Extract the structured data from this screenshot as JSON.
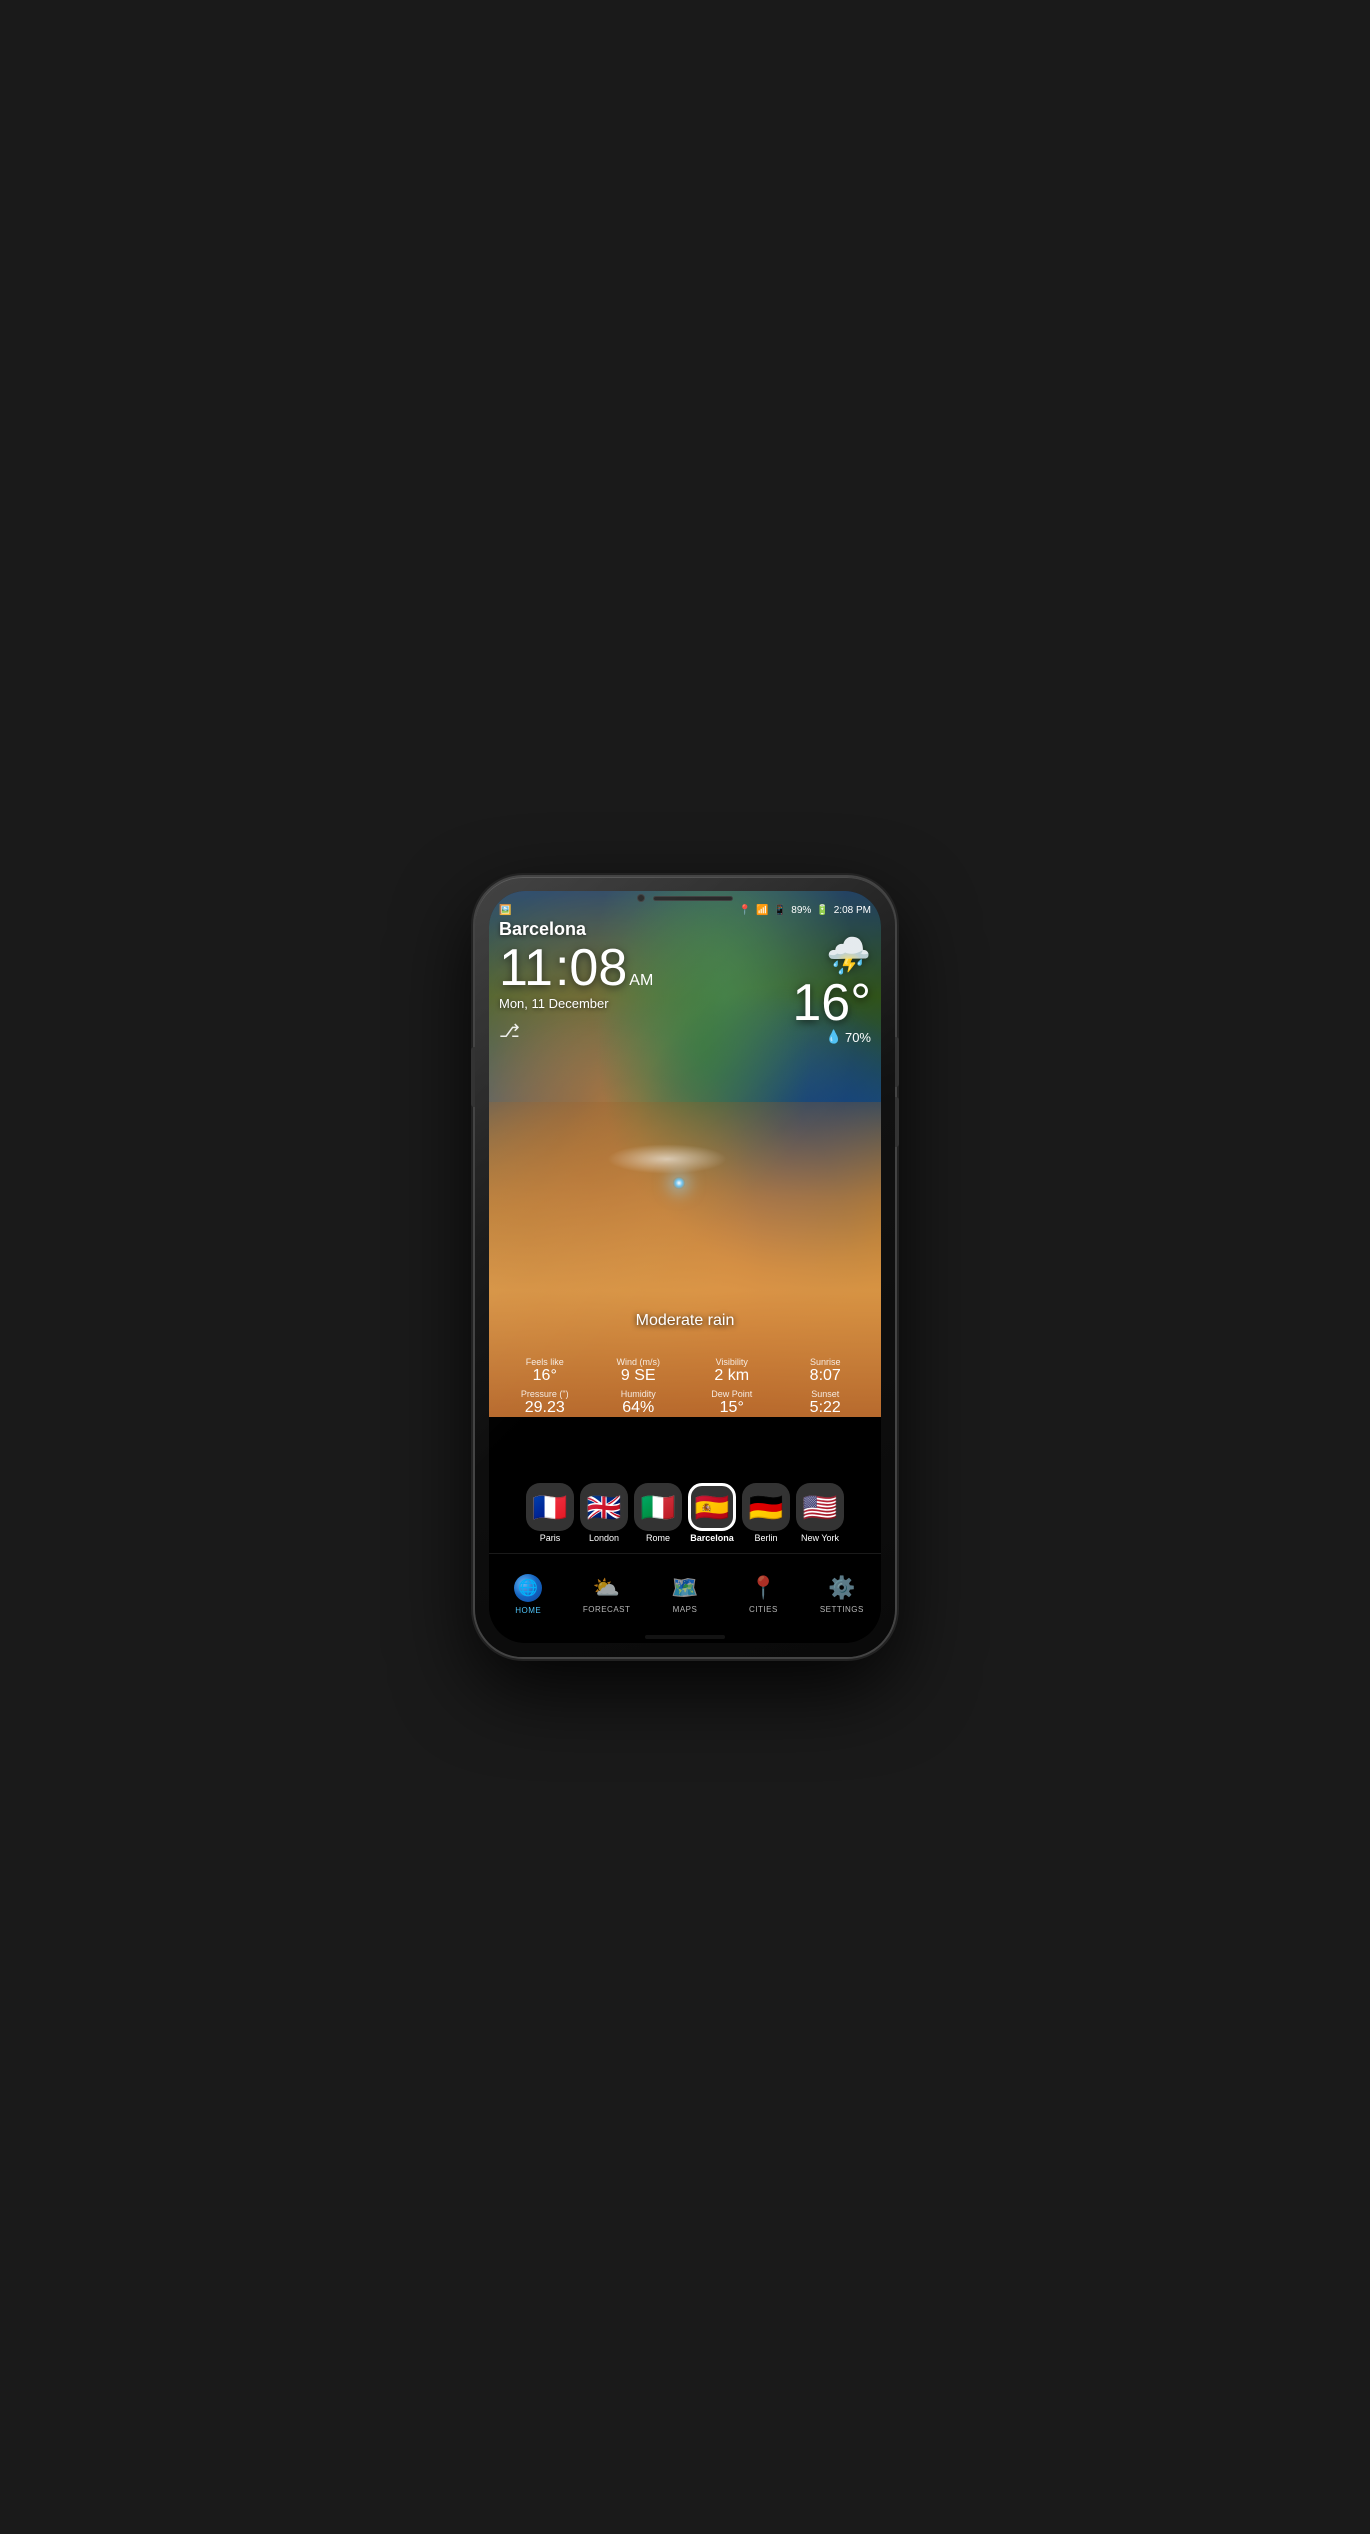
{
  "phone": {
    "statusBar": {
      "location_icon": "📍",
      "wifi_icon": "wifi",
      "signal_icon": "signal",
      "battery": "89%",
      "battery_icon": "🔋",
      "time": "2:08 PM"
    },
    "weather": {
      "city": "Barcelona",
      "time": "11",
      "time_minutes": ":08",
      "time_ampm": "AM",
      "date": "Mon, 11 December",
      "temperature": "16°",
      "humidity": "70%",
      "condition": "Moderate rain",
      "feels_like_label": "Feels like",
      "feels_like": "16°",
      "wind_label": "Wind (m/s)",
      "wind": "9 SE",
      "visibility_label": "Visibility",
      "visibility": "2 km",
      "sunrise_label": "Sunrise",
      "sunrise": "8:07",
      "pressure_label": "Pressure (\")",
      "pressure": "29.23",
      "humidity_label": "Humidity",
      "humidity_val": "64%",
      "dew_point_label": "Dew Point",
      "dew_point": "15°",
      "sunset_label": "Sunset",
      "sunset": "5:22"
    },
    "cities": [
      {
        "name": "Paris",
        "flag": "🇫🇷",
        "active": false
      },
      {
        "name": "London",
        "flag": "🇬🇧",
        "active": false
      },
      {
        "name": "Rome",
        "flag": "🇮🇹",
        "active": false
      },
      {
        "name": "Barcelona",
        "flag": "🇪🇸",
        "active": true
      },
      {
        "name": "Berlin",
        "flag": "🇩🇪",
        "active": false
      },
      {
        "name": "New York",
        "flag": "🇺🇸",
        "active": false
      }
    ],
    "nav": [
      {
        "id": "home",
        "label": "HOME",
        "icon": "🌐",
        "active": true
      },
      {
        "id": "forecast",
        "label": "FORECAST",
        "icon": "⛅",
        "active": false
      },
      {
        "id": "maps",
        "label": "MAPS",
        "icon": "🗺️",
        "active": false
      },
      {
        "id": "cities",
        "label": "CITIES",
        "icon": "📍",
        "active": false
      },
      {
        "id": "settings",
        "label": "SETTINGS",
        "icon": "⚙️",
        "active": false
      }
    ]
  }
}
